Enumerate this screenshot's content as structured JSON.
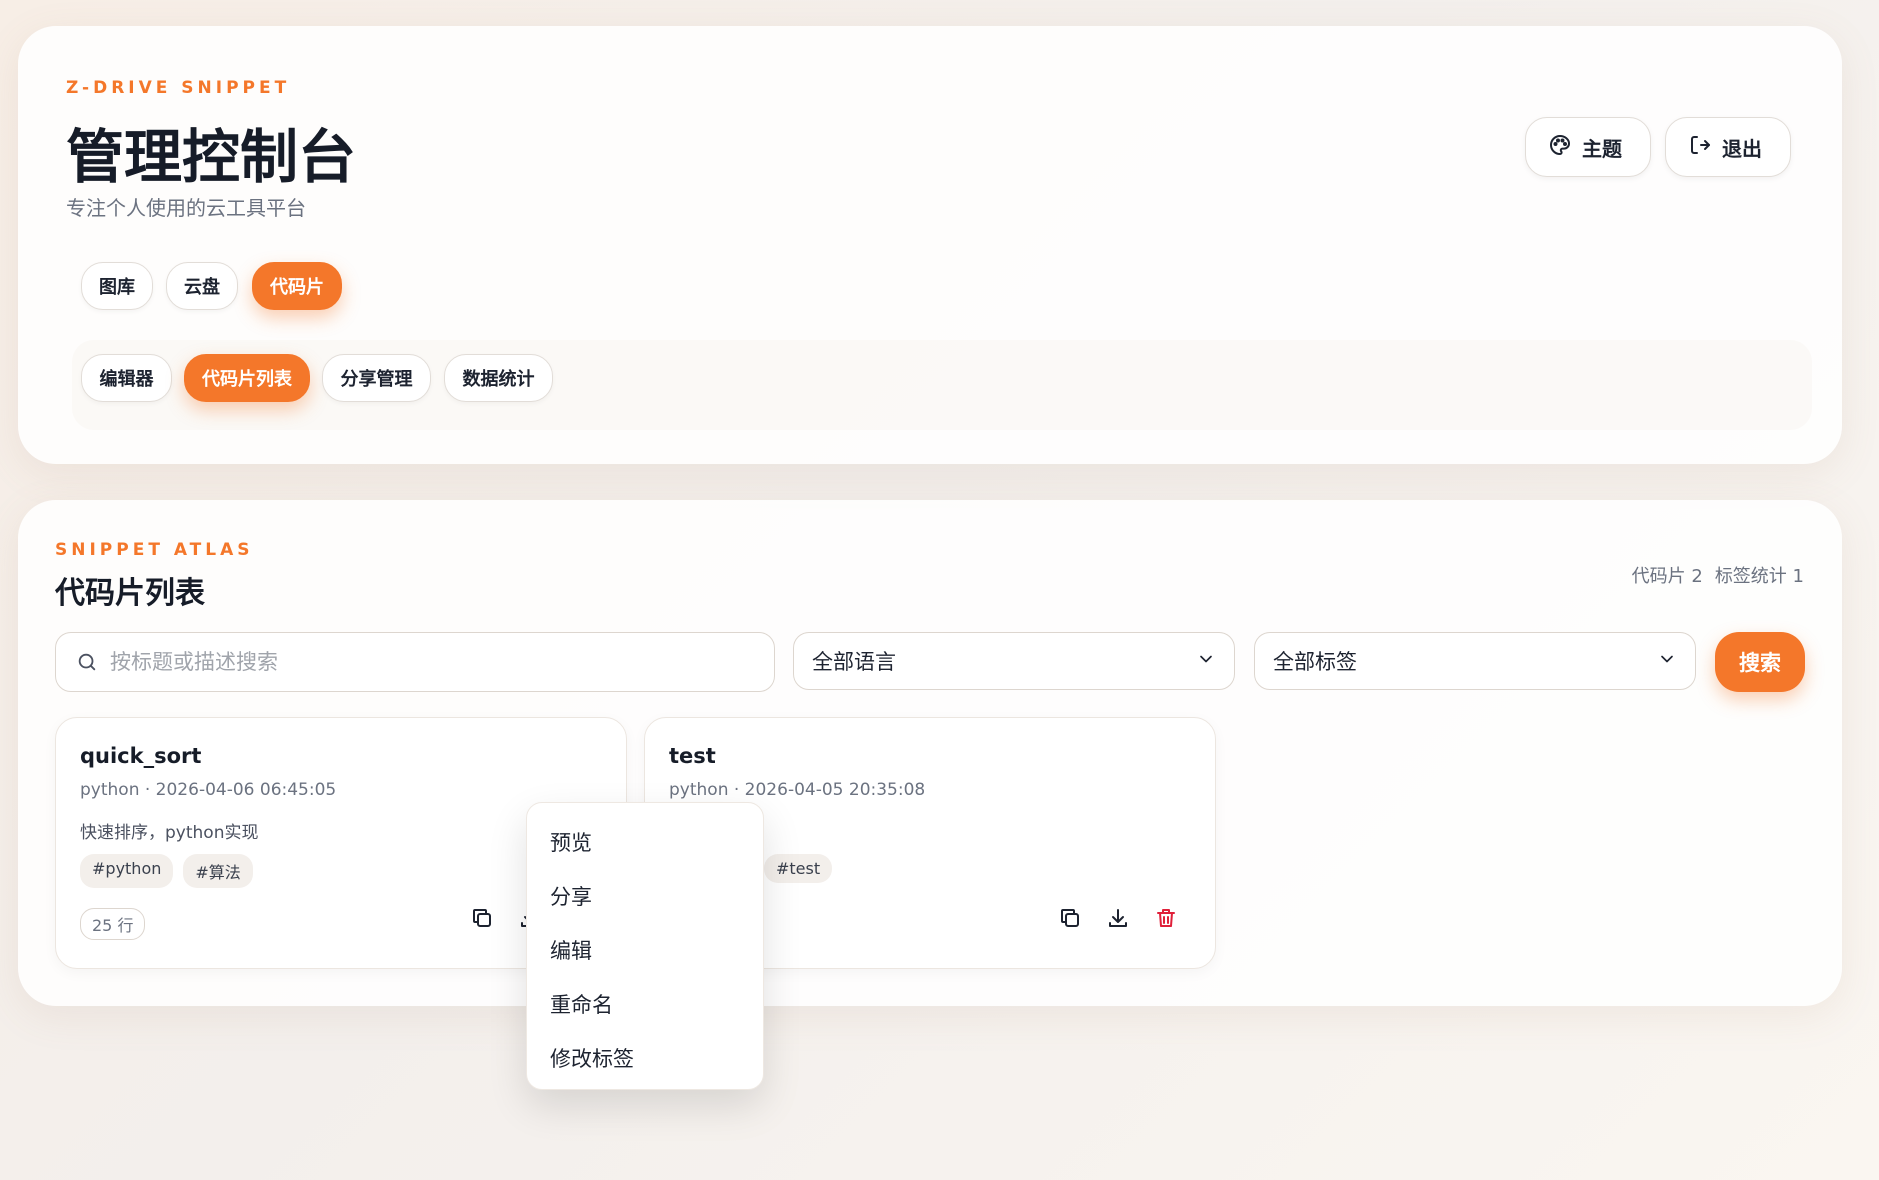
{
  "header": {
    "eyebrow": "Z-DRIVE SNIPPET",
    "title": "管理控制台",
    "subtitle": "专注个人使用的云工具平台",
    "theme_label": "主题",
    "logout_label": "退出",
    "icons": {
      "theme": "palette-icon",
      "logout": "logout-icon"
    }
  },
  "main_nav": [
    {
      "label": "图库",
      "active": false
    },
    {
      "label": "云盘",
      "active": false
    },
    {
      "label": "代码片",
      "active": true
    }
  ],
  "sub_nav": [
    {
      "label": "编辑器",
      "active": false
    },
    {
      "label": "代码片列表",
      "active": true
    },
    {
      "label": "分享管理",
      "active": false
    },
    {
      "label": "数据统计",
      "active": false
    }
  ],
  "list": {
    "eyebrow": "SNIPPET ATLAS",
    "title": "代码片列表",
    "stats": {
      "snippets": "代码片 2",
      "tags": "标签统计 1"
    },
    "search_placeholder": "按标题或描述搜索",
    "search_value": "",
    "language_select": "全部语言",
    "tag_select": "全部标签",
    "search_button": "搜索"
  },
  "snippets": [
    {
      "title": "quick_sort",
      "meta": "python · 2026-04-06 06:45:05",
      "description": "快速排序，python实现",
      "tags": [
        "#python",
        "#算法"
      ],
      "lines": "25 行"
    },
    {
      "title": "test",
      "meta": "python · 2026-04-05 20:35:08",
      "description": "",
      "tags": [
        "#test"
      ],
      "lines": ""
    }
  ],
  "context_menu": [
    "预览",
    "分享",
    "编辑",
    "重命名",
    "修改标签"
  ],
  "colors": {
    "accent": "#f4772a",
    "danger": "#e0203a"
  }
}
